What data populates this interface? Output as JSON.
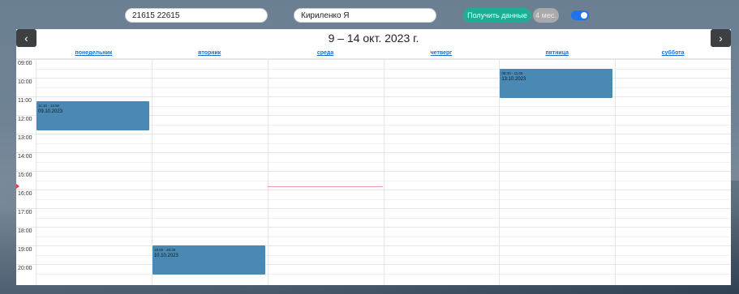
{
  "topbar": {
    "phone_value": "21615 22615",
    "teacher_value": "Кириленко Я",
    "get_data_label": "Получить данные",
    "months_label": "4 мес."
  },
  "calendar": {
    "title": "9 – 14 окт. 2023 г.",
    "prev_icon": "chevron-left-icon",
    "next_icon": "chevron-right-icon",
    "prev_glyph": "‹",
    "next_glyph": "›",
    "days": [
      "понедельник",
      "вторник",
      "среда",
      "четверг",
      "пятница",
      "суббота"
    ],
    "hours": [
      "09:00",
      "10:00",
      "11:00",
      "12:00",
      "13:00",
      "14:00",
      "15:00",
      "16:00",
      "17:00",
      "18:00",
      "19:00",
      "20:00"
    ],
    "events": [
      {
        "day": 0,
        "start": "11:15",
        "end": "12:50",
        "time": "11:15 - 12:50",
        "date": "09.10.2023"
      },
      {
        "day": 1,
        "start": "19:00",
        "end": "20:35",
        "time": "19:00 - 20:35",
        "date": "10.10.2023"
      },
      {
        "day": 4,
        "start": "09:30",
        "end": "11:05",
        "time": "09:30 - 11:05",
        "date": "13.10.2023"
      }
    ],
    "now_time": "15:50",
    "now_day": 2
  },
  "colors": {
    "accent": "#1fae95",
    "event": "#4a89b3",
    "toggle": "#1e74e8",
    "link": "#1a6fcf",
    "now": "#ef9a9a"
  }
}
